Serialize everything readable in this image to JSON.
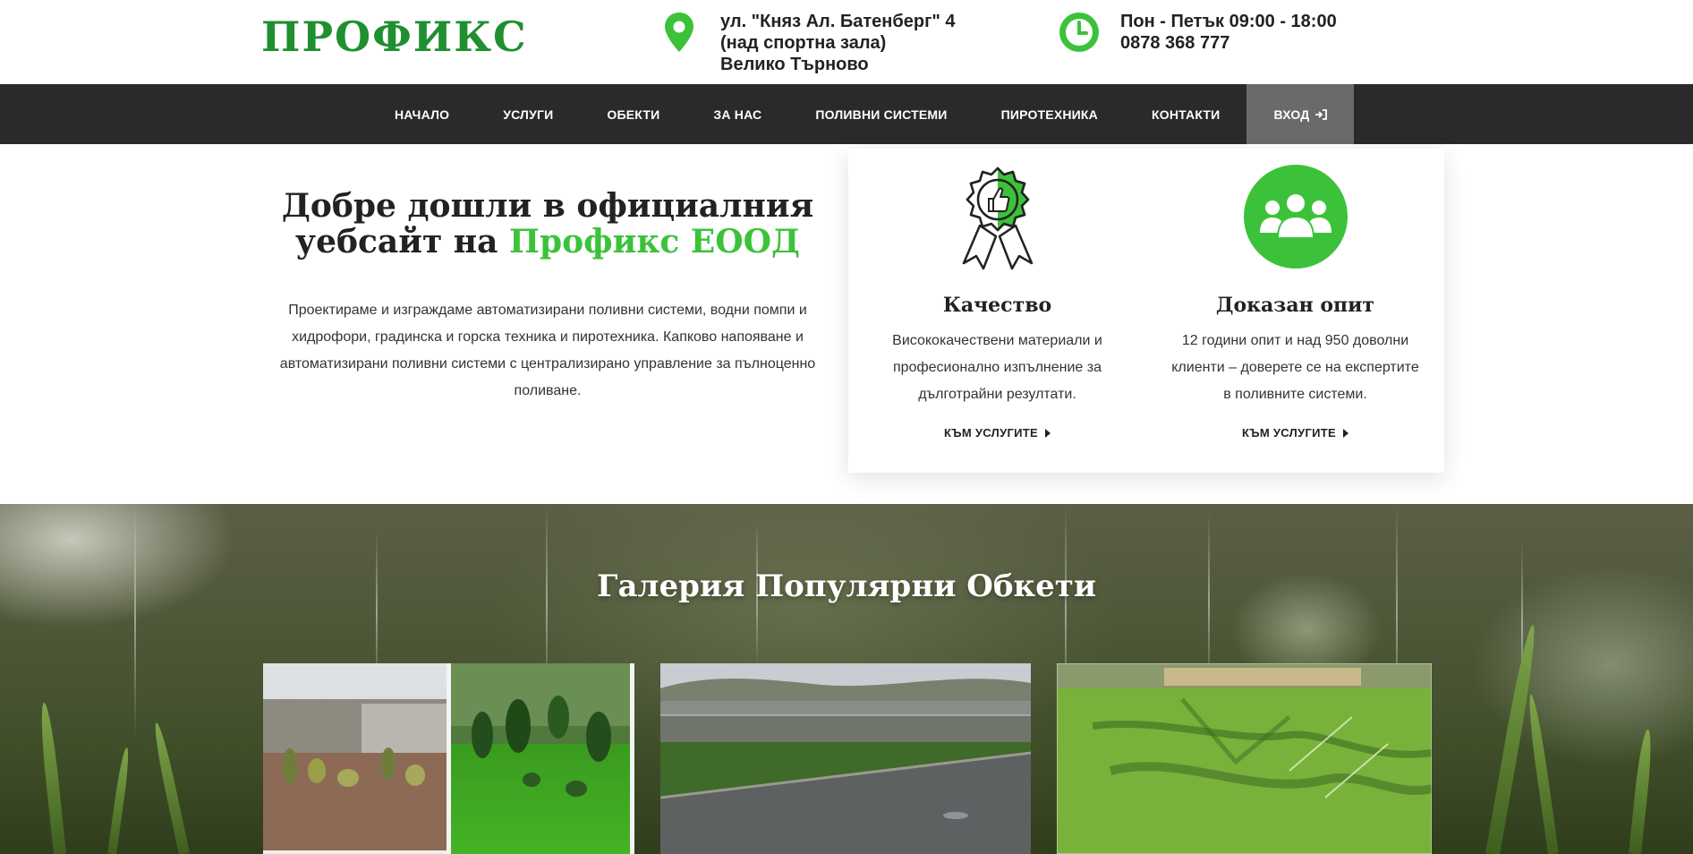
{
  "header": {
    "logo_text": "ПРОФИКС",
    "address_lines": [
      "ул. \"Княз Ал. Батенберг\" 4",
      "(над спортна зала)",
      "Велико Търново"
    ],
    "hours": "Пон - Петък 09:00 - 18:00",
    "phone": "0878 368 777"
  },
  "nav": {
    "items": [
      {
        "label": "НАЧАЛО"
      },
      {
        "label": "УСЛУГИ"
      },
      {
        "label": "ОБЕКТИ"
      },
      {
        "label": "ЗА НАС"
      },
      {
        "label": "ПОЛИВНИ СИСТЕМИ"
      },
      {
        "label": "ПИРОТЕХНИКА"
      },
      {
        "label": "КОНТАКТИ"
      }
    ],
    "login_label": "ВХОД"
  },
  "welcome": {
    "title_part1": "Добре дошли в официалния уебсайт на ",
    "title_accent": "Профикс ЕООД",
    "description": "Проектираме и изграждаме автоматизирани поливни системи, водни помпи и хидрофори, градинска и горска техника и пиротехника. Капково напояване и автоматизирани поливни системи с централизирано управление за пълноценно поливане."
  },
  "features": [
    {
      "icon": "award-badge-icon",
      "title": "Качество",
      "description": "Висококачествени материали и професионално изпълнение за дълготрайни резултати.",
      "link_label": "КЪМ УСЛУГИТЕ"
    },
    {
      "icon": "group-users-icon",
      "title": "Доказан опит",
      "description": "12 години опит и над 950 доволни клиенти – доверете се на експертите в поливните системи.",
      "link_label": "КЪМ УСЛУГИТЕ"
    }
  ],
  "gallery": {
    "title": "Галерия Популярни Обкети"
  },
  "colors": {
    "brand_green": "#1f8f2f",
    "accent_green": "#3cc23a",
    "nav_bg": "#2a2a2a",
    "nav_active_bg": "#6a6a6a"
  }
}
